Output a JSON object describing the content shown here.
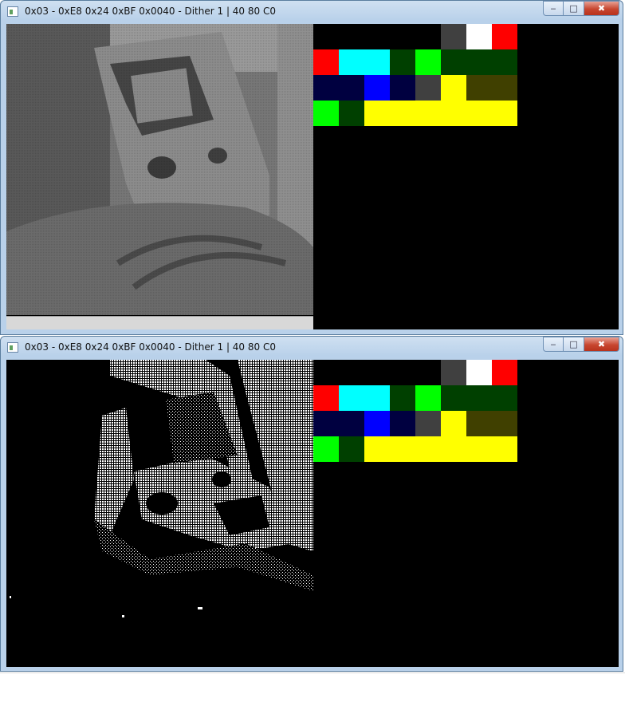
{
  "windows": [
    {
      "title": "0x03 - 0xE8 0x24 0xBF 0x0040 - Dither 1 | 40 80 C0",
      "view": "grayscale camera"
    },
    {
      "title": "0x03 - 0xE8 0x24 0xBF 0x0040 - Dither 1 | 40 80 C0",
      "view": "dithered camera"
    }
  ],
  "caption_buttons": {
    "minimize": "‒",
    "maximize": "□",
    "close": "✖"
  },
  "palette": {
    "rows": [
      [
        "#000000",
        "#000000",
        "#000000",
        "#000000",
        "#000000",
        "#404040",
        "#ffffff",
        "#ff0000"
      ],
      [
        "#ff0000",
        "#00ffff",
        "#00ffff",
        "#004000",
        "#00ff00",
        "#004000",
        "#004000",
        "#004000"
      ],
      [
        "#000040",
        "#000040",
        "#0000ff",
        "#000040",
        "#404040",
        "#ffff00",
        "#404000",
        "#404000"
      ],
      [
        "#00ff00",
        "#004000",
        "#ffff00",
        "#ffff00",
        "#ffff00",
        "#ffff00",
        "#ffff00",
        "#ffff00"
      ]
    ]
  },
  "colors": {
    "client_bg": "#000000",
    "frame": "#b9d1ea"
  }
}
